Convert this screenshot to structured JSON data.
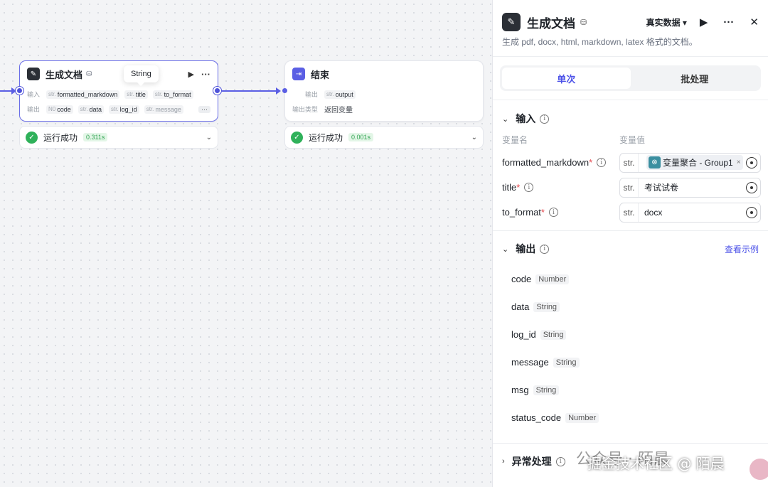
{
  "canvas": {
    "gen_node": {
      "title": "生成文档",
      "tooltip": "String",
      "input_label": "输入",
      "output_label": "输出",
      "inputs": [
        {
          "type": "str.",
          "name": "formatted_markdown"
        },
        {
          "type": "str.",
          "name": "title"
        },
        {
          "type": "str.",
          "name": "to_format"
        }
      ],
      "outputs": [
        {
          "type": "N0",
          "name": "code"
        },
        {
          "type": "str.",
          "name": "data"
        },
        {
          "type": "str.",
          "name": "log_id"
        },
        {
          "type": "str.",
          "name": "message"
        }
      ],
      "more": "···",
      "run_icon": "▶",
      "more_icon": "···",
      "status": "运行成功",
      "time": "0.311s"
    },
    "end_node": {
      "title": "结束",
      "output_label": "输出",
      "output": {
        "type": "str.",
        "name": "output"
      },
      "output_type_label": "输出类型",
      "output_type_value": "返回变量",
      "status": "运行成功",
      "time": "0.001s"
    }
  },
  "panel": {
    "title": "生成文档",
    "data_select": "真实数据 ▾",
    "run_icon": "▶",
    "more_icon": "···",
    "close_icon": "✕",
    "description": "生成 pdf, docx, html, markdown, latex 格式的文档。",
    "tabs": [
      "单次",
      "批处理"
    ],
    "input_section": {
      "title": "输入",
      "col_name": "变量名",
      "col_value": "变量值",
      "rows": [
        {
          "name": "formatted_markdown",
          "type": "str.",
          "chip": "变量聚合 - Group1"
        },
        {
          "name": "title",
          "type": "str.",
          "value": "考试试卷"
        },
        {
          "name": "to_format",
          "type": "str.",
          "value": "docx"
        }
      ]
    },
    "output_section": {
      "title": "输出",
      "link": "查看示例",
      "items": [
        {
          "name": "code",
          "type": "Number"
        },
        {
          "name": "data",
          "type": "String"
        },
        {
          "name": "log_id",
          "type": "String"
        },
        {
          "name": "message",
          "type": "String"
        },
        {
          "name": "msg",
          "type": "String"
        },
        {
          "name": "status_code",
          "type": "Number"
        }
      ]
    },
    "error_section": {
      "title": "异常处理"
    }
  },
  "watermark": "掘金技术社区 @ 陌晨",
  "watermark_bg": "公众号 · 陌晨"
}
